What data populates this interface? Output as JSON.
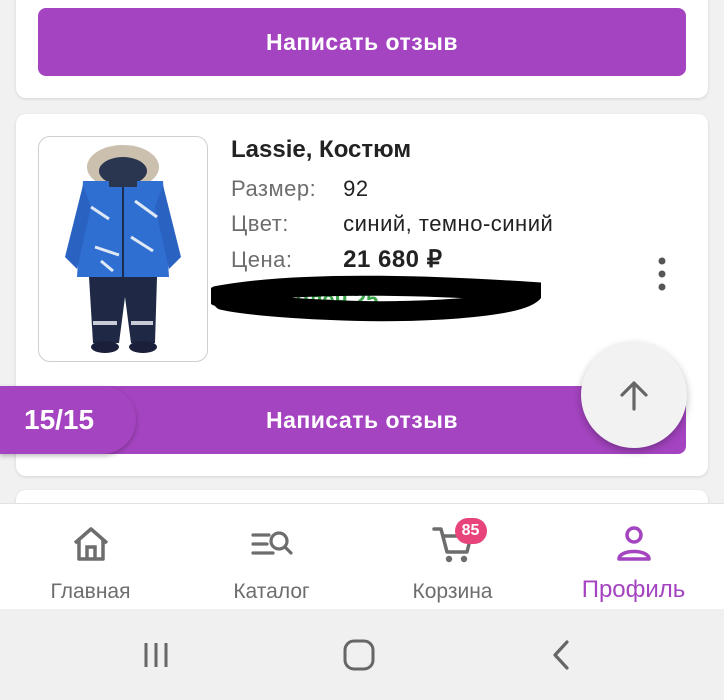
{
  "cards": {
    "top": {
      "review_label": "Написать отзыв"
    },
    "product": {
      "title": "Lassie, Костюм",
      "size_label": "Размер:",
      "size_value": "92",
      "color_label": "Цвет:",
      "color_value": "синий, темно-синий",
      "price_label": "Цена:",
      "price_value": "21 680 ₽",
      "delivery_text": "Доставлен 25",
      "review_label": "Написать отзыв"
    }
  },
  "counter": "15/15",
  "nav": {
    "items": [
      {
        "label": "Главная",
        "icon": "home-icon"
      },
      {
        "label": "Каталог",
        "icon": "catalog-search-icon"
      },
      {
        "label": "Корзина",
        "icon": "cart-icon",
        "badge": "85"
      },
      {
        "label": "Профиль",
        "icon": "profile-icon",
        "active": true
      }
    ]
  },
  "colors": {
    "accent": "#a444c0",
    "badge": "#e8437a",
    "delivered": "#3aa648"
  }
}
